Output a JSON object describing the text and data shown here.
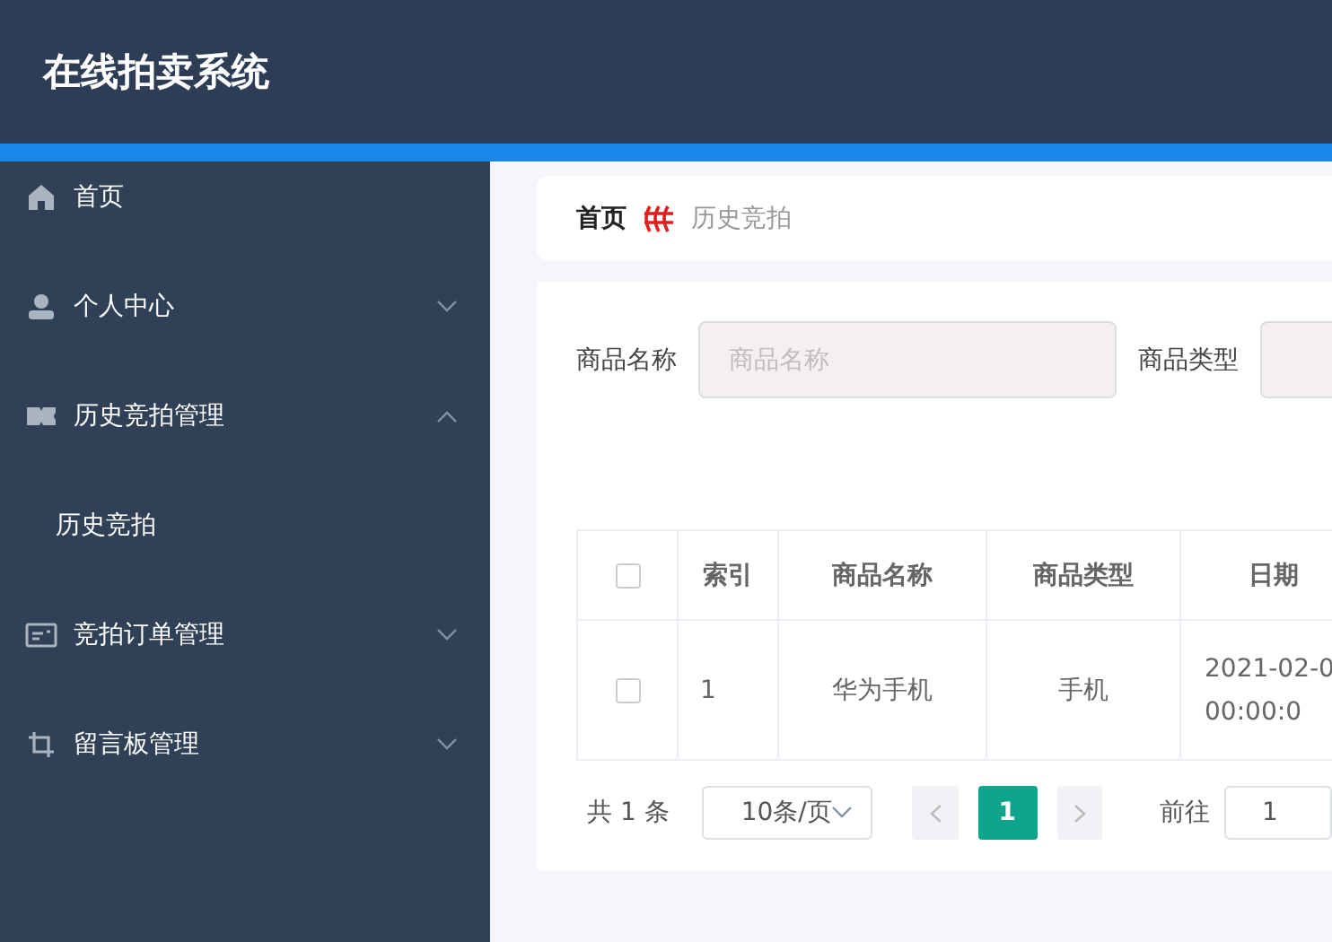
{
  "header": {
    "title": "在线拍卖系统"
  },
  "sidebar": {
    "items": [
      {
        "label": "首页",
        "kind": "link"
      },
      {
        "label": "个人中心",
        "kind": "group",
        "expanded": false
      },
      {
        "label": "历史竞拍管理",
        "kind": "group",
        "expanded": true,
        "children": [
          {
            "label": "历史竞拍"
          }
        ]
      },
      {
        "label": "竞拍订单管理",
        "kind": "group",
        "expanded": false
      },
      {
        "label": "留言板管理",
        "kind": "group",
        "expanded": false
      }
    ]
  },
  "breadcrumb": [
    "首页",
    "历史竞拍"
  ],
  "filters": [
    {
      "label": "商品名称",
      "placeholder": "商品名称"
    },
    {
      "label": "商品类型"
    }
  ],
  "table": {
    "columns": [
      "索引",
      "商品名称",
      "商品类型",
      "日期"
    ],
    "all_checked": false,
    "rows": [
      {
        "checked": false,
        "cells": [
          "1",
          "华为手机",
          "手机"
        ],
        "date": "2021-02-0",
        "time": "00:00:0"
      }
    ]
  },
  "pagination": {
    "total": "共 1 条",
    "page_size": "10条/页",
    "pages": [
      {
        "label": "1",
        "selected": true
      }
    ],
    "goto_label": "前往",
    "goto_value": "1"
  }
}
